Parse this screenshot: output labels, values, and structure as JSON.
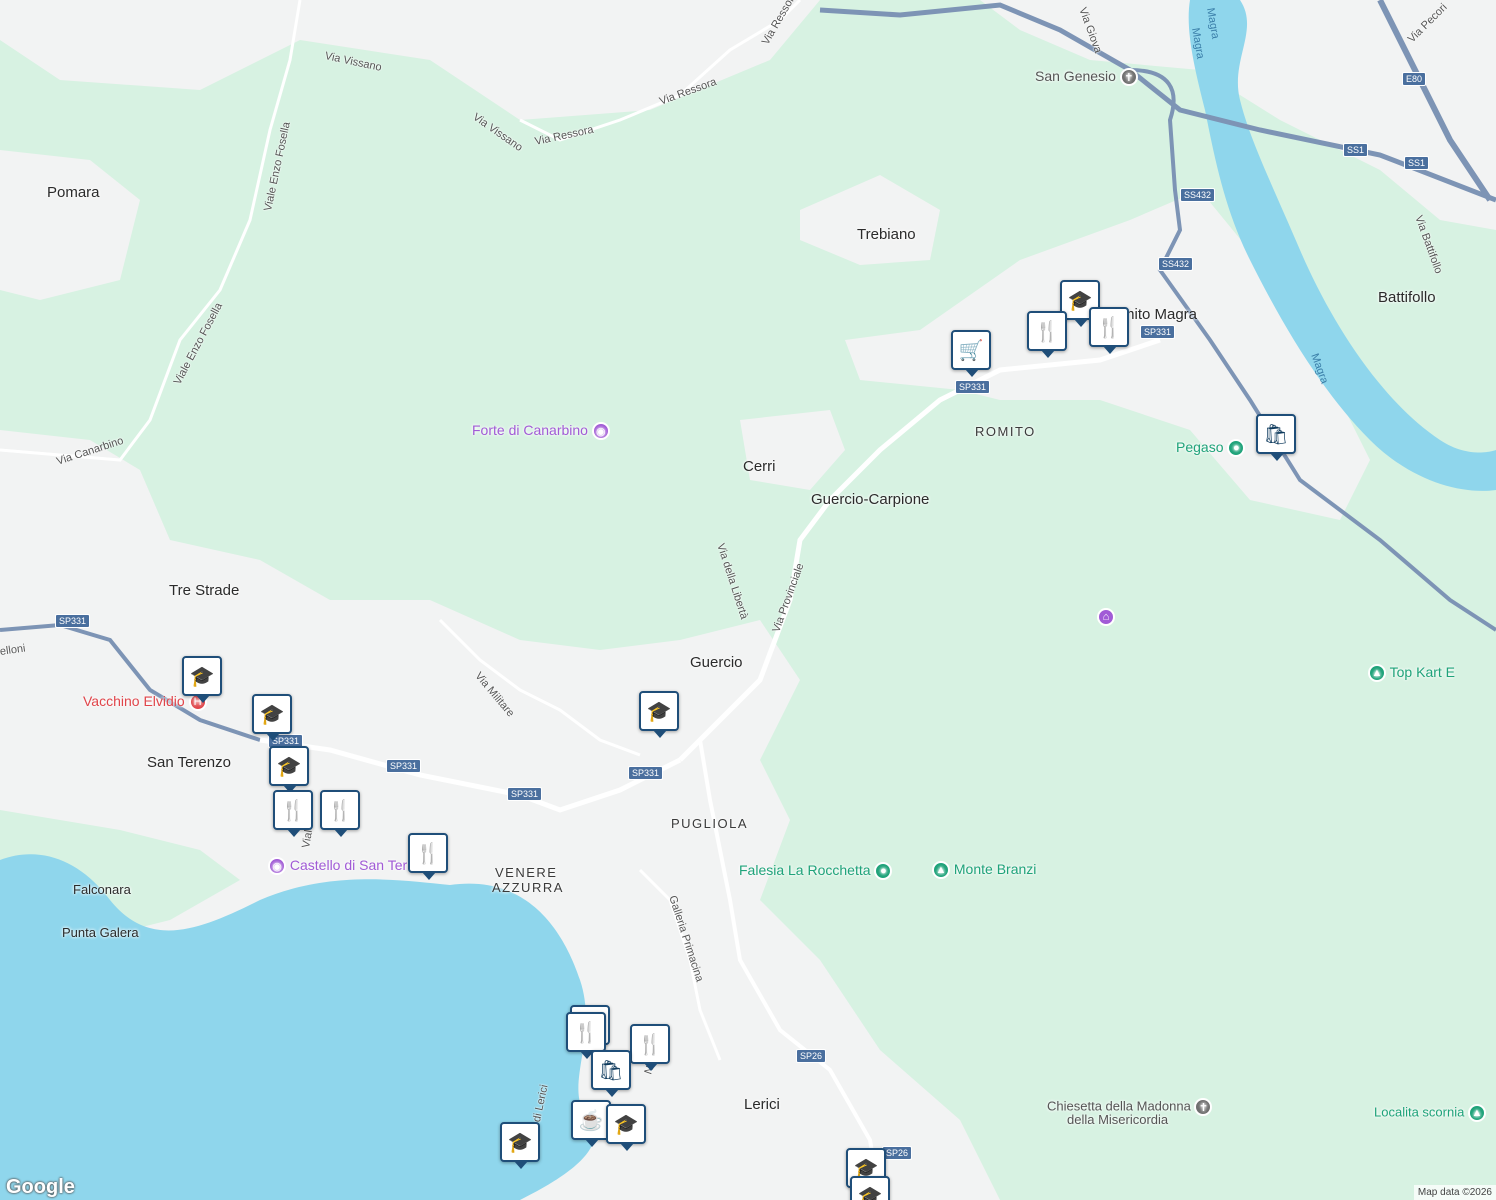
{
  "places": [
    {
      "id": "pomara",
      "text": "Pomara"
    },
    {
      "id": "trebiano",
      "text": "Trebiano"
    },
    {
      "id": "romito-magra",
      "text": "mito Magra"
    },
    {
      "id": "battifollo",
      "text": "Battifollo"
    },
    {
      "id": "cerri",
      "text": "Cerri"
    },
    {
      "id": "guercio-carpione",
      "text": "Guercio-Carpione"
    },
    {
      "id": "tre-strade",
      "text": "Tre Strade"
    },
    {
      "id": "guercio",
      "text": "Guercio"
    },
    {
      "id": "san-terenzo",
      "text": "San Terenzo"
    },
    {
      "id": "lerici",
      "text": "Lerici"
    },
    {
      "id": "falconara",
      "text": "Falconara"
    },
    {
      "id": "punta-galera",
      "text": "Punta Galera"
    }
  ],
  "districts": [
    {
      "id": "romito",
      "text": "ROMITO"
    },
    {
      "id": "pugliola",
      "text": "PUGLIOLA"
    },
    {
      "id": "venere",
      "text": "VENERE"
    },
    {
      "id": "azzurra",
      "text": "AZZURRA"
    }
  ],
  "streets": [
    {
      "id": "via-vissano-1",
      "text": "Via Vissano"
    },
    {
      "id": "via-vissano-2",
      "text": "Via Vissano"
    },
    {
      "id": "via-ressora-1",
      "text": "Via Ressora"
    },
    {
      "id": "via-ressora-2",
      "text": "Via Ressora"
    },
    {
      "id": "via-ressora-3",
      "text": "Via Ressora"
    },
    {
      "id": "viale-enzo-fosella-1",
      "text": "Viale Enzo Fosella"
    },
    {
      "id": "viale-enzo-fosella-2",
      "text": "Viale Enzo Fosella"
    },
    {
      "id": "via-canarbino",
      "text": "Via Canarbino"
    },
    {
      "id": "via-della-liberta",
      "text": "Via della Libertà"
    },
    {
      "id": "via-provinciale",
      "text": "Via Provinciale"
    },
    {
      "id": "via-militare",
      "text": "Via Militare"
    },
    {
      "id": "galleria-primacina",
      "text": "Galleria Primacina"
    },
    {
      "id": "via-battifollo",
      "text": "Via Battifollo"
    },
    {
      "id": "via-pecori",
      "text": "Via Pecori"
    },
    {
      "id": "via-giovanni",
      "text": "Via Giova"
    },
    {
      "id": "via-elloni",
      "text": "elloni"
    },
    {
      "id": "via-nino",
      "text": "Nino"
    },
    {
      "id": "vicolo-lerici",
      "text": "Vicolo di Lerici"
    },
    {
      "id": "viale-santerenzo",
      "text": "Vial"
    }
  ],
  "water_labels": [
    {
      "id": "magra-1",
      "text": "Magra"
    },
    {
      "id": "magra-2",
      "text": "Magra"
    },
    {
      "id": "magra-3",
      "text": "Magra"
    }
  ],
  "pois": [
    {
      "id": "forte-di-canarbino",
      "text": "Forte di Canarbino",
      "color": "#a15bd6",
      "icon": "camera-icon"
    },
    {
      "id": "san-genesio",
      "text": "San Genesio",
      "color": "#6f6f6f",
      "icon": "cross-icon"
    },
    {
      "id": "pegaso",
      "text": "Pegaso",
      "color": "#1fa37a",
      "icon": "dot-icon"
    },
    {
      "id": "vacchino-elvidio",
      "text": "Vacchino Elvidio",
      "color": "#e0454a",
      "icon": "hospital-icon"
    },
    {
      "id": "castello-di-san-terenzo",
      "text": "Castello di San Ter",
      "color": "#a15bd6",
      "icon": "camera-icon"
    },
    {
      "id": "falesia-la-rocchetta",
      "text": "Falesia La Rocchetta",
      "color": "#1fa37a",
      "icon": "dot-icon"
    },
    {
      "id": "monte-branzi",
      "text": "Monte Branzi",
      "color": "#1fa37a",
      "icon": "tree-icon"
    },
    {
      "id": "top-kart",
      "text": "Top Kart E",
      "color": "#1fa37a",
      "icon": "tree-icon"
    },
    {
      "id": "chiesetta",
      "text": "Chiesetta della Madonna",
      "color": "#6f6f6f",
      "icon": "cross-icon"
    },
    {
      "id": "chiesetta-2",
      "text": "della Misericordia",
      "color": "#6f6f6f",
      "icon": ""
    },
    {
      "id": "localita-scornia",
      "text": "Localita scornia",
      "color": "#1fa37a",
      "icon": "tree-icon"
    }
  ],
  "road_shields": [
    {
      "id": "e80",
      "text": "E80"
    },
    {
      "id": "ss1-a",
      "text": "SS1"
    },
    {
      "id": "ss1-b",
      "text": "SS1"
    },
    {
      "id": "ss432-a",
      "text": "SS432"
    },
    {
      "id": "ss432-b",
      "text": "SS432"
    },
    {
      "id": "sp331-a",
      "text": "SP331"
    },
    {
      "id": "sp331-b",
      "text": "SP331"
    },
    {
      "id": "sp331-c",
      "text": "SP331"
    },
    {
      "id": "sp331-d",
      "text": "SP331"
    },
    {
      "id": "sp331-e",
      "text": "SP331"
    },
    {
      "id": "sp331-f",
      "text": "SP331"
    },
    {
      "id": "sp331-g",
      "text": "SP331"
    },
    {
      "id": "sp26-a",
      "text": "SP26"
    },
    {
      "id": "sp26-b",
      "text": "SP26"
    }
  ],
  "markers": [
    {
      "id": "m1",
      "icon": "graduation-cap-icon",
      "glyph": "🎓"
    },
    {
      "id": "m2",
      "icon": "fork-knife-icon",
      "glyph": "🍴"
    },
    {
      "id": "m3",
      "icon": "fork-knife-icon",
      "glyph": "🍴"
    },
    {
      "id": "m4",
      "icon": "shopping-cart-icon",
      "glyph": "🛒"
    },
    {
      "id": "m5",
      "icon": "shopping-bag-icon",
      "glyph": "🛍"
    },
    {
      "id": "m6",
      "icon": "graduation-cap-icon",
      "glyph": "🎓"
    },
    {
      "id": "m7",
      "icon": "graduation-cap-icon",
      "glyph": "🎓"
    },
    {
      "id": "m8",
      "icon": "graduation-cap-icon",
      "glyph": "🎓"
    },
    {
      "id": "m9",
      "icon": "graduation-cap-icon",
      "glyph": "🎓"
    },
    {
      "id": "m10",
      "icon": "fork-knife-icon",
      "glyph": "🍴"
    },
    {
      "id": "m11",
      "icon": "fork-knife-icon",
      "glyph": "🍴"
    },
    {
      "id": "m12",
      "icon": "fork-knife-icon",
      "glyph": "🍴"
    },
    {
      "id": "m13",
      "icon": "fork-knife-icon",
      "glyph": "🍴"
    },
    {
      "id": "m14",
      "icon": "fork-knife-icon",
      "glyph": "🍴"
    },
    {
      "id": "m15",
      "icon": "fork-knife-icon",
      "glyph": "🍴"
    },
    {
      "id": "m16",
      "icon": "shopping-bag-icon",
      "glyph": "🛍"
    },
    {
      "id": "m17",
      "icon": "coffee-cup-icon",
      "glyph": "☕"
    },
    {
      "id": "m18",
      "icon": "graduation-cap-icon",
      "glyph": "🎓"
    },
    {
      "id": "m19",
      "icon": "graduation-cap-icon",
      "glyph": "🎓"
    },
    {
      "id": "m20",
      "icon": "graduation-cap-icon",
      "glyph": "🎓"
    },
    {
      "id": "m21",
      "icon": "graduation-cap-icon",
      "glyph": "🎓"
    }
  ],
  "branding": {
    "logo": "Google",
    "attribution": "Map data ©2026"
  },
  "colors": {
    "forest": "#d7f2e2",
    "urban": "#f3f3f4",
    "water": "#8fd6ec",
    "highway": "#7d94b5",
    "marker_border": "#1f4e79"
  }
}
